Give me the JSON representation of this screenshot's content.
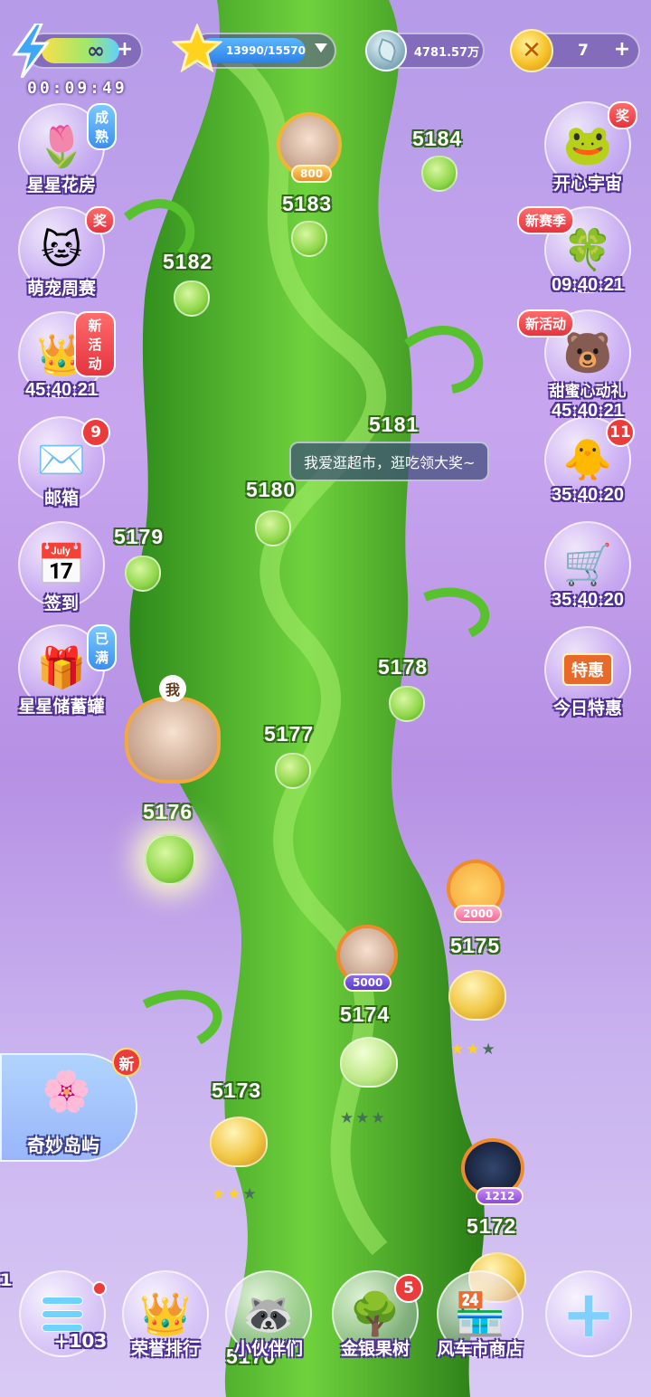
{
  "topbar": {
    "energy_value": "∞",
    "stars_value": "13990/15570",
    "coins_value": "4781.57万",
    "gold_value": "7",
    "energy_timer": "00:09:49"
  },
  "left_features": [
    {
      "label": "星星花房",
      "badge": "成熟",
      "icon": "flower-icon"
    },
    {
      "label": "萌宠周赛",
      "badge": "奖",
      "icon": "cat-icon"
    },
    {
      "label": "",
      "badge": "新活动",
      "icon": "crown-ticket-icon",
      "timer": "45:40:21"
    },
    {
      "label": "邮箱",
      "badge": "9",
      "icon": "mail-icon"
    },
    {
      "label": "签到",
      "badge": "",
      "icon": "calendar-icon"
    },
    {
      "label": "星星储蓄罐",
      "badge": "已满",
      "icon": "piggy-bank-icon"
    }
  ],
  "right_features": [
    {
      "label": "开心宇宙",
      "badge": "奖",
      "icon": "frog-planet-icon"
    },
    {
      "label": "",
      "badge": "新赛季",
      "icon": "clover-badge-icon",
      "timer": "09:40:21"
    },
    {
      "label": "甜蜜心动礼",
      "badge": "新活动",
      "icon": "bear-gift-icon",
      "timer": "45:40:21"
    },
    {
      "label": "",
      "badge": "11",
      "icon": "chick-basket-icon",
      "timer": "35:40:20"
    },
    {
      "label": "",
      "badge": "",
      "icon": "shopping-cart-icon",
      "timer": "35:40:20"
    },
    {
      "label": "今日特惠",
      "badge": "",
      "icon": "shop-sale-icon",
      "sign": "特惠"
    }
  ],
  "levels": [
    {
      "num": "5184"
    },
    {
      "num": "5183"
    },
    {
      "num": "5182"
    },
    {
      "num": "5181"
    },
    {
      "num": "5180"
    },
    {
      "num": "5179"
    },
    {
      "num": "5178"
    },
    {
      "num": "5177"
    },
    {
      "num": "5176"
    },
    {
      "num": "5175",
      "stars": 2
    },
    {
      "num": "5174",
      "stars": 0
    },
    {
      "num": "5173",
      "stars": 2
    },
    {
      "num": "5172"
    },
    {
      "num": "5170"
    }
  ],
  "avatars": {
    "a1": "800",
    "me": "我",
    "a2": "5000",
    "a3": "2000",
    "a4": "1212"
  },
  "speech_bubble": "我爱逛超市，逛吃领大奖~",
  "island": {
    "label": "奇妙岛屿",
    "badge": "新"
  },
  "bottom_bar": {
    "menu_count": "+103",
    "side_num": "1",
    "items": [
      {
        "label": "荣誉排行",
        "icon": "crown-gift-icon",
        "badge": ""
      },
      {
        "label": "小伙伴们",
        "icon": "raccoon-icon",
        "badge": ""
      },
      {
        "label": "金银果树",
        "icon": "fruit-tree-icon",
        "badge": "5"
      },
      {
        "label": "风车市商店",
        "icon": "store-icon",
        "badge": ""
      }
    ]
  },
  "colors": {
    "background": "#c3a4ee",
    "stalk": "#4cb82a",
    "accent_red": "#e5343f",
    "star_on": "#ffd21e"
  }
}
